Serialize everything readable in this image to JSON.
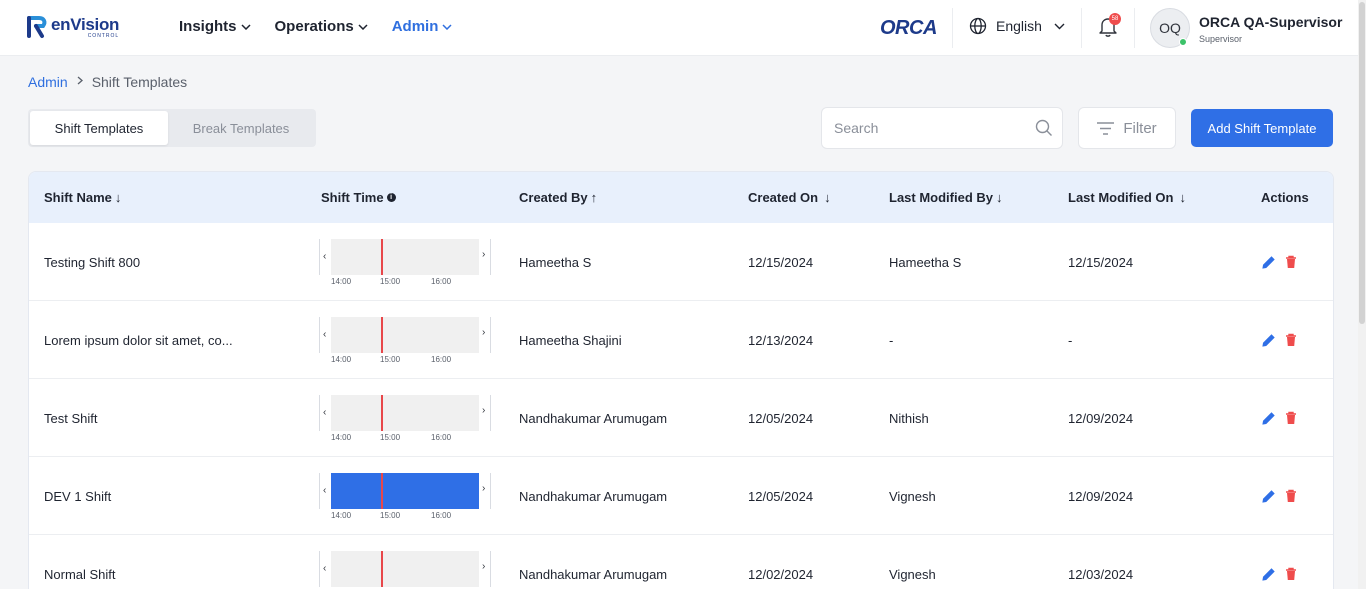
{
  "header": {
    "logo_name": "enVision",
    "logo_sub": "CONTROL",
    "nav": [
      {
        "label": "Insights"
      },
      {
        "label": "Operations"
      },
      {
        "label": "Admin"
      }
    ],
    "brand": "ORCA",
    "language": "English",
    "notifications_count": "58",
    "avatar_initials": "OQ",
    "user_name": "ORCA QA-Supervisor",
    "user_role": "Supervisor",
    "accent_color": "#2f6fe6"
  },
  "breadcrumb": {
    "root": "Admin",
    "current": "Shift Templates"
  },
  "tabs": [
    {
      "label": "Shift Templates",
      "active": true
    },
    {
      "label": "Break Templates",
      "active": false
    }
  ],
  "toolbar": {
    "search_placeholder": "Search",
    "search_value": "",
    "filter_label": "Filter",
    "add_label": "Add Shift Template"
  },
  "table": {
    "columns": [
      {
        "label": "Shift Name",
        "sort": "↓"
      },
      {
        "label": "Shift Time",
        "sort": ""
      },
      {
        "label": "Created By",
        "sort": "↑"
      },
      {
        "label": "Created On",
        "sort": "↓"
      },
      {
        "label": "Last Modified By",
        "sort": "↓"
      },
      {
        "label": "Last Modified On",
        "sort": "↓"
      },
      {
        "label": "Actions",
        "sort": ""
      }
    ],
    "timeline_ticks": [
      "14:00",
      "15:00",
      "16:00"
    ],
    "rows": [
      {
        "name": "Testing Shift 800",
        "created_by": "Hameetha S",
        "created_on": "12/15/2024",
        "modified_by": "Hameetha S",
        "modified_on": "12/15/2024",
        "fill": 0
      },
      {
        "name": "Lorem ipsum dolor sit amet, co...",
        "created_by": "Hameetha Shajini",
        "created_on": "12/13/2024",
        "modified_by": "-",
        "modified_on": "-",
        "fill": 0
      },
      {
        "name": "Test Shift",
        "created_by": "Nandhakumar Arumugam",
        "created_on": "12/05/2024",
        "modified_by": "Nithish",
        "modified_on": "12/09/2024",
        "fill": 0
      },
      {
        "name": "DEV 1 Shift",
        "created_by": "Nandhakumar Arumugam",
        "created_on": "12/05/2024",
        "modified_by": "Vignesh",
        "modified_on": "12/09/2024",
        "fill": 1
      },
      {
        "name": "Normal Shift",
        "created_by": "Nandhakumar Arumugam",
        "created_on": "12/02/2024",
        "modified_by": "Vignesh",
        "modified_on": "12/03/2024",
        "fill": 0
      }
    ]
  }
}
